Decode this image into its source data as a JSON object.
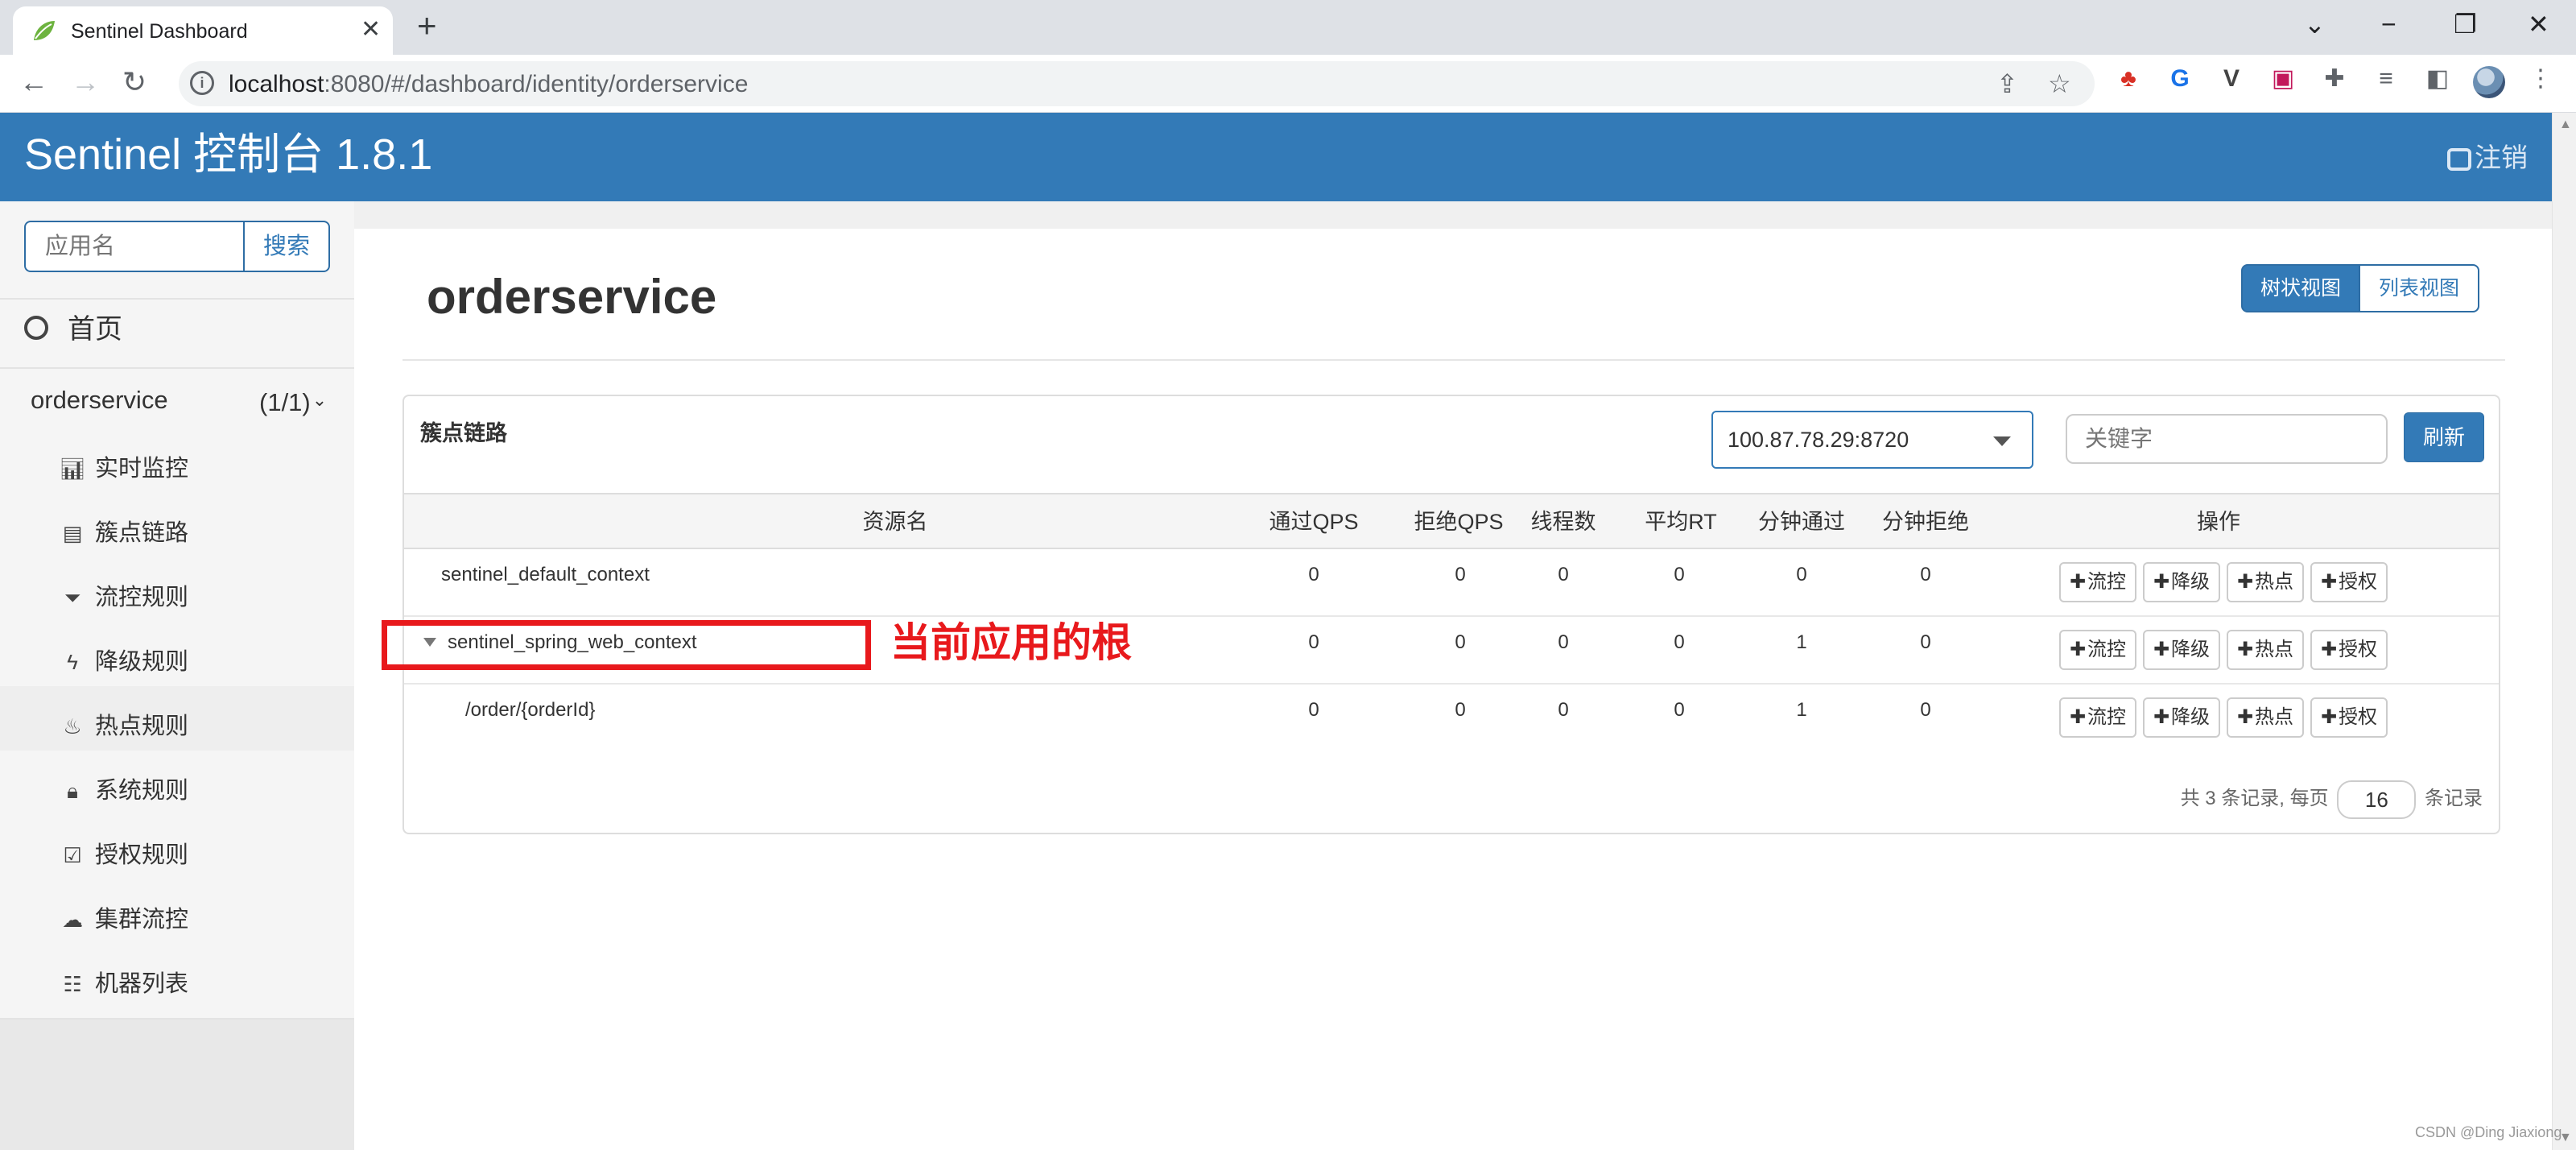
{
  "browser": {
    "tab_title": "Sentinel Dashboard",
    "url_host": "localhost",
    "url_rest": ":8080/#/dashboard/identity/orderservice"
  },
  "header": {
    "brand": "Sentinel 控制台 1.8.1",
    "logout": "注销"
  },
  "sidebar": {
    "search_placeholder": "应用名",
    "search_button": "搜索",
    "home": "首页",
    "app_name": "orderservice",
    "app_count": "(1/1)",
    "items": [
      {
        "label": "实时监控",
        "icon": "bar-chart-icon"
      },
      {
        "label": "簇点链路",
        "icon": "list-icon"
      },
      {
        "label": "流控规则",
        "icon": "filter-icon"
      },
      {
        "label": "降级规则",
        "icon": "flash-icon"
      },
      {
        "label": "热点规则",
        "icon": "fire-icon"
      },
      {
        "label": "系统规则",
        "icon": "lock-icon"
      },
      {
        "label": "授权规则",
        "icon": "check-icon"
      },
      {
        "label": "集群流控",
        "icon": "cloud-icon"
      },
      {
        "label": "机器列表",
        "icon": "th-list-icon"
      }
    ]
  },
  "main": {
    "title": "orderservice",
    "view_tree": "树状视图",
    "view_list": "列表视图",
    "panel_title": "簇点链路",
    "machine": "100.87.78.29:8720",
    "keyword_placeholder": "关键字",
    "refresh": "刷新",
    "columns": [
      "资源名",
      "通过QPS",
      "拒绝QPS",
      "线程数",
      "平均RT",
      "分钟通过",
      "分钟拒绝",
      "操作"
    ],
    "rows": [
      {
        "name": "sentinel_default_context",
        "values": [
          "0",
          "0",
          "0",
          "0",
          "0",
          "0"
        ]
      },
      {
        "name": "sentinel_spring_web_context",
        "values": [
          "0",
          "0",
          "0",
          "0",
          "1",
          "0"
        ]
      },
      {
        "name": "/order/{orderId}",
        "values": [
          "0",
          "0",
          "0",
          "0",
          "1",
          "0"
        ]
      }
    ],
    "ops": [
      "流控",
      "降级",
      "热点",
      "授权"
    ],
    "pager_prefix": "共 3 条记录, 每页",
    "page_size": "16",
    "pager_suffix": "条记录"
  },
  "annotation": "当前应用的根",
  "watermark": "CSDN @Ding Jiaxiong",
  "colors": {
    "primary": "#337ab7",
    "annotation": "#e8191c"
  }
}
